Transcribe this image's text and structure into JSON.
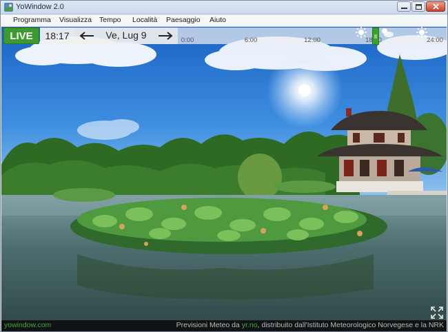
{
  "window": {
    "title": "YoWindow 2.0"
  },
  "menu": [
    "Programma",
    "Visualizza",
    "Tempo",
    "Località",
    "Paesaggio",
    "Aiuto"
  ],
  "toolbar": {
    "live_label": "LIVE",
    "current_time": "18:17",
    "date": "Ve, Lug 9"
  },
  "timeline": {
    "ticks": [
      "0:00",
      "6:00",
      "12:00",
      "18:00",
      "24:00"
    ],
    "current_hour_fraction": 0.76,
    "icons": [
      "sun-icon",
      "partly-cloudy-icon",
      "sun-icon"
    ]
  },
  "footer": {
    "site": "yowindow.com",
    "credit_prefix": "Previsioni Meteo da ",
    "credit_link": "yr.no",
    "credit_suffix": ", distribuito dall'Istituto Meteorologico Norvegese e la NRK"
  },
  "colors": {
    "live_green": "#3c9a2e",
    "sky_blue": "#2f7fd6",
    "link_green": "#3faa3a"
  }
}
